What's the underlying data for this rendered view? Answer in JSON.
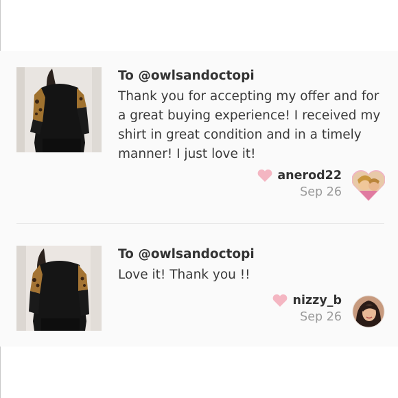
{
  "reviews": [
    {
      "to": "To @owlsandoctopi",
      "body": "Thank you for accepting my offer and for a great buying experience! I received my shirt in great condition and in a timely manner! I just love it!",
      "username": "anerod22",
      "date": "Sep 26"
    },
    {
      "to": "To @owlsandoctopi",
      "body": "Love it! Thank you !!",
      "username": "nizzy_b",
      "date": "Sep 26"
    }
  ],
  "colors": {
    "panel_bg": "#fafafa",
    "heart": "#f4b6c2",
    "date": "#9a9a9a"
  }
}
